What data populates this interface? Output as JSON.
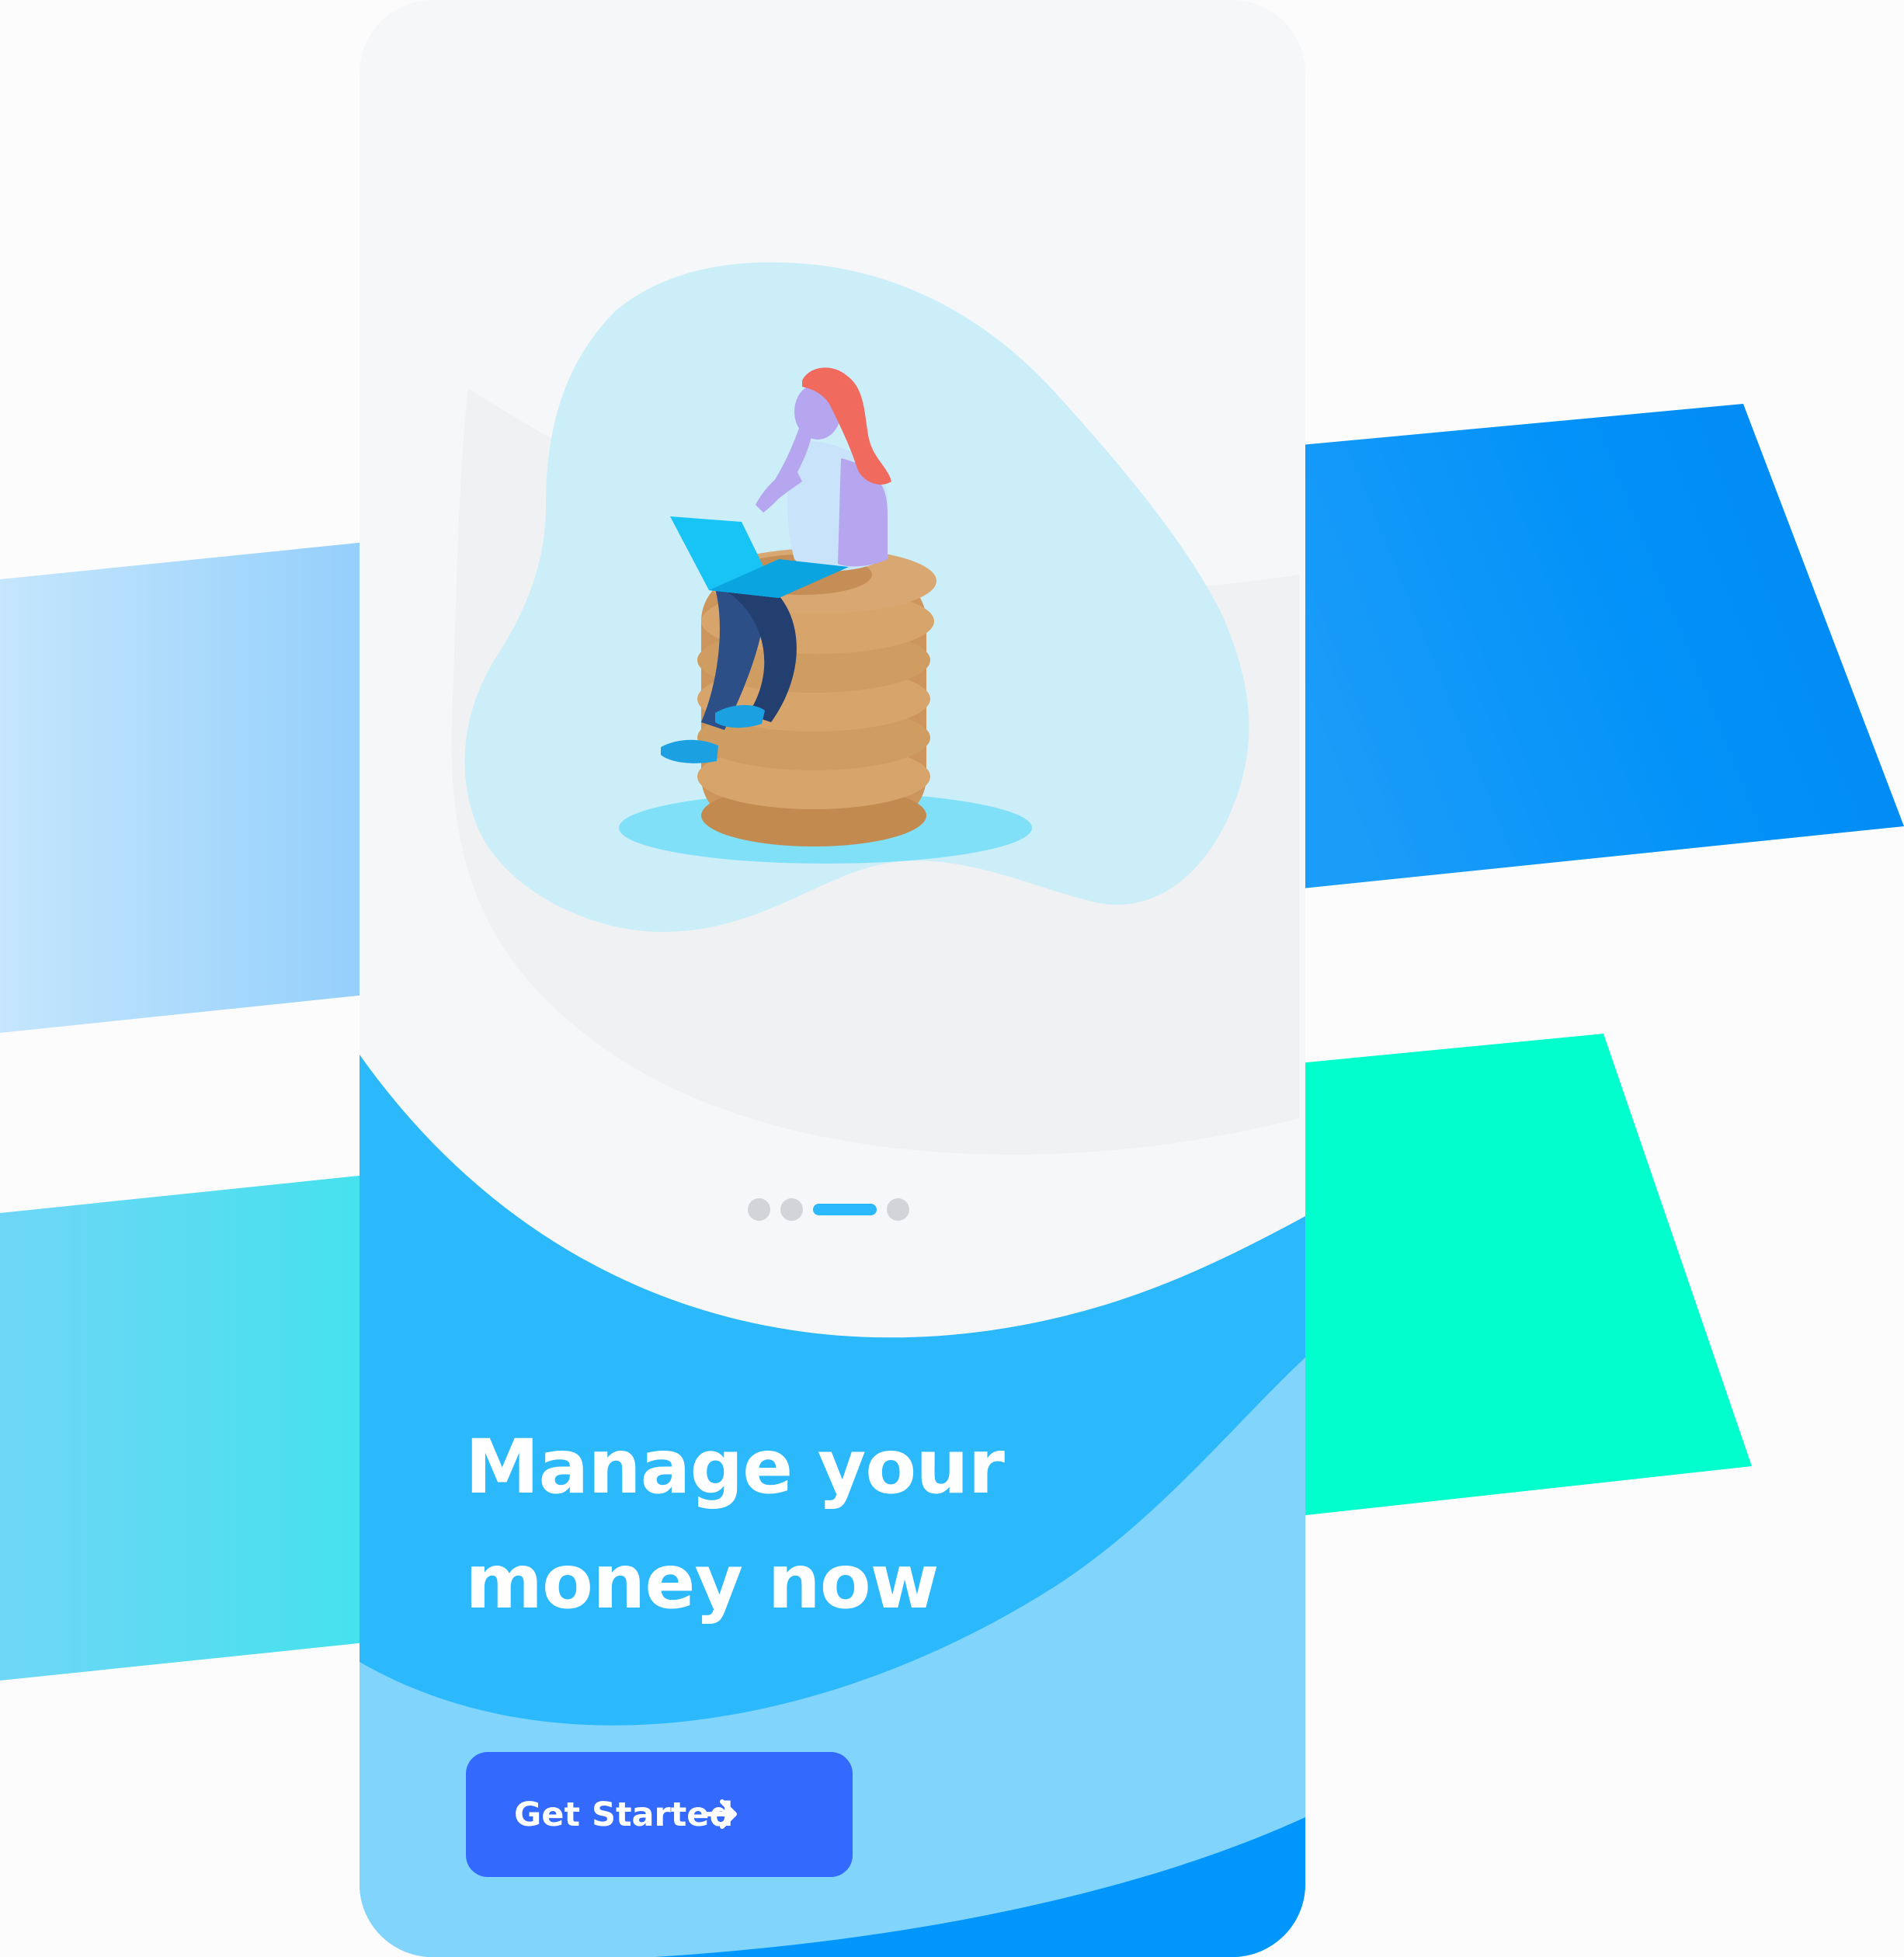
{
  "onboarding": {
    "headline_line1": "Manage your",
    "headline_line2": "money now",
    "cta_label": "Get Started",
    "cta_icon": "arrow-right-icon",
    "pager": {
      "total": 4,
      "active_index": 2
    }
  },
  "illustration": {
    "subject": "woman-with-laptop-on-coin-stack"
  },
  "colors": {
    "phone_background": "#f6f7f9",
    "wave_primary": "#2cb9fc",
    "wave_light": "#81d5fd",
    "wave_dark": "#0096fb",
    "cta_background": "#3469fe",
    "pager_active": "#2cb9fc",
    "pager_inactive": "#d2d4d8",
    "stripe_blue": "#0392f9",
    "stripe_light_blue": "#9cd2fc",
    "stripe_mint": "#00ffcd",
    "stripe_cyan": "#4fe1ee"
  }
}
